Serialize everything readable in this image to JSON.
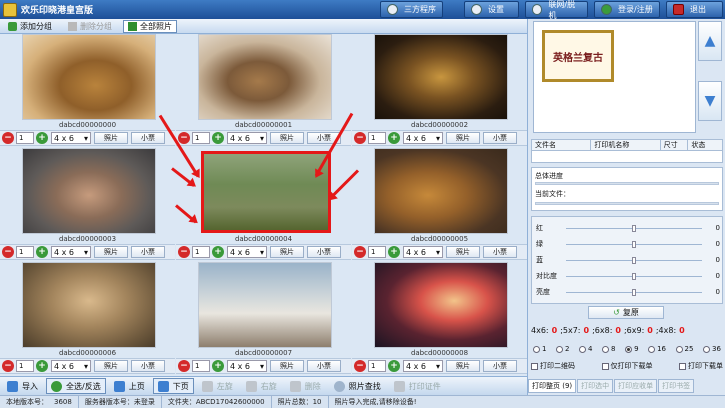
{
  "app": {
    "title": "欢乐印晓港皇宫版"
  },
  "top_buttons": [
    {
      "label": "三方程序",
      "icon": "app-icon"
    },
    {
      "label": "设置",
      "icon": "gear-icon"
    },
    {
      "label": "联网/脱机",
      "icon": "network-icon"
    },
    {
      "label": "登录/注册",
      "icon": "user-icon"
    },
    {
      "label": "退出",
      "icon": "exit-icon"
    }
  ],
  "toolbar": {
    "add_group": "添加分组",
    "delete_group": "删除分组",
    "all_photos": "全部照片"
  },
  "photos": [
    {
      "id": "dabcd00000000",
      "qty": "1",
      "size": "4 x 6",
      "photo_btn": "照片",
      "ticket_btn": "小票"
    },
    {
      "id": "dabcd00000001",
      "qty": "1",
      "size": "4 x 6",
      "photo_btn": "照片",
      "ticket_btn": "小票"
    },
    {
      "id": "dabcd00000002",
      "qty": "1",
      "size": "4 x 6",
      "photo_btn": "照片",
      "ticket_btn": "小票"
    },
    {
      "id": "dabcd00000003",
      "qty": "1",
      "size": "4 x 6",
      "photo_btn": "照片",
      "ticket_btn": "小票"
    },
    {
      "id": "dabcd00000004",
      "qty": "1",
      "size": "4 x 6",
      "photo_btn": "照片",
      "ticket_btn": "小票"
    },
    {
      "id": "dabcd00000005",
      "qty": "1",
      "size": "4 x 6",
      "photo_btn": "照片",
      "ticket_btn": "小票"
    },
    {
      "id": "dabcd00000006",
      "qty": "1",
      "size": "4 x 6",
      "photo_btn": "照片",
      "ticket_btn": "小票"
    },
    {
      "id": "dabcd00000007",
      "qty": "1",
      "size": "4 x 6",
      "photo_btn": "照片",
      "ticket_btn": "小票"
    },
    {
      "id": "dabcd00000008",
      "qty": "1",
      "size": "4 x 6",
      "photo_btn": "照片",
      "ticket_btn": "小票"
    }
  ],
  "bottom_bar": {
    "import": "导入",
    "select_all": "全选/反选",
    "prev_page": "上页",
    "next_page": "下页",
    "rotate_left": "左旋",
    "rotate_right": "右旋",
    "delete": "删除",
    "photo_search": "照片查找",
    "print_id": "打印证件"
  },
  "status": {
    "local_version_label": "本地版本号：",
    "local_version": "3608",
    "server_version_label": "服务器版本号：",
    "server_version": "未登录",
    "folder_label": "文件夹：",
    "folder": "ABCD17042600000",
    "total_label": "照片总数：",
    "total": "10",
    "message": "照片导入完成,请移除设备!"
  },
  "right": {
    "preview_text": "英格兰复古",
    "table_headers": [
      "文件名",
      "打印机名称",
      "尺寸",
      "状态"
    ],
    "total_progress_label": "总体进度",
    "current_file_label": "当前文件：",
    "total_progress": 0,
    "current_progress": 0,
    "sliders": [
      {
        "label": "红",
        "value": "0"
      },
      {
        "label": "绿",
        "value": "0"
      },
      {
        "label": "蓝",
        "value": "0"
      },
      {
        "label": "对比度",
        "value": "0"
      },
      {
        "label": "亮度",
        "value": "0"
      }
    ],
    "reset_label": "复原",
    "counts": [
      {
        "label": "4x6:",
        "value": "0"
      },
      {
        "label": ";5x7:",
        "value": "0"
      },
      {
        "label": ";6x8:",
        "value": "0"
      },
      {
        "label": ";6x9:",
        "value": "0"
      },
      {
        "label": ";4x8:",
        "value": "0"
      }
    ],
    "radios": [
      "1",
      "2",
      "4",
      "8",
      "9",
      "16",
      "25",
      "36"
    ],
    "radio_selected": "9",
    "checkboxes": [
      "打印二维码",
      "仅打印下载单",
      "打印下载单"
    ],
    "print_tabs": [
      "打印整页 (9)",
      "打印选中",
      "打印应收单",
      "打印书签"
    ]
  }
}
